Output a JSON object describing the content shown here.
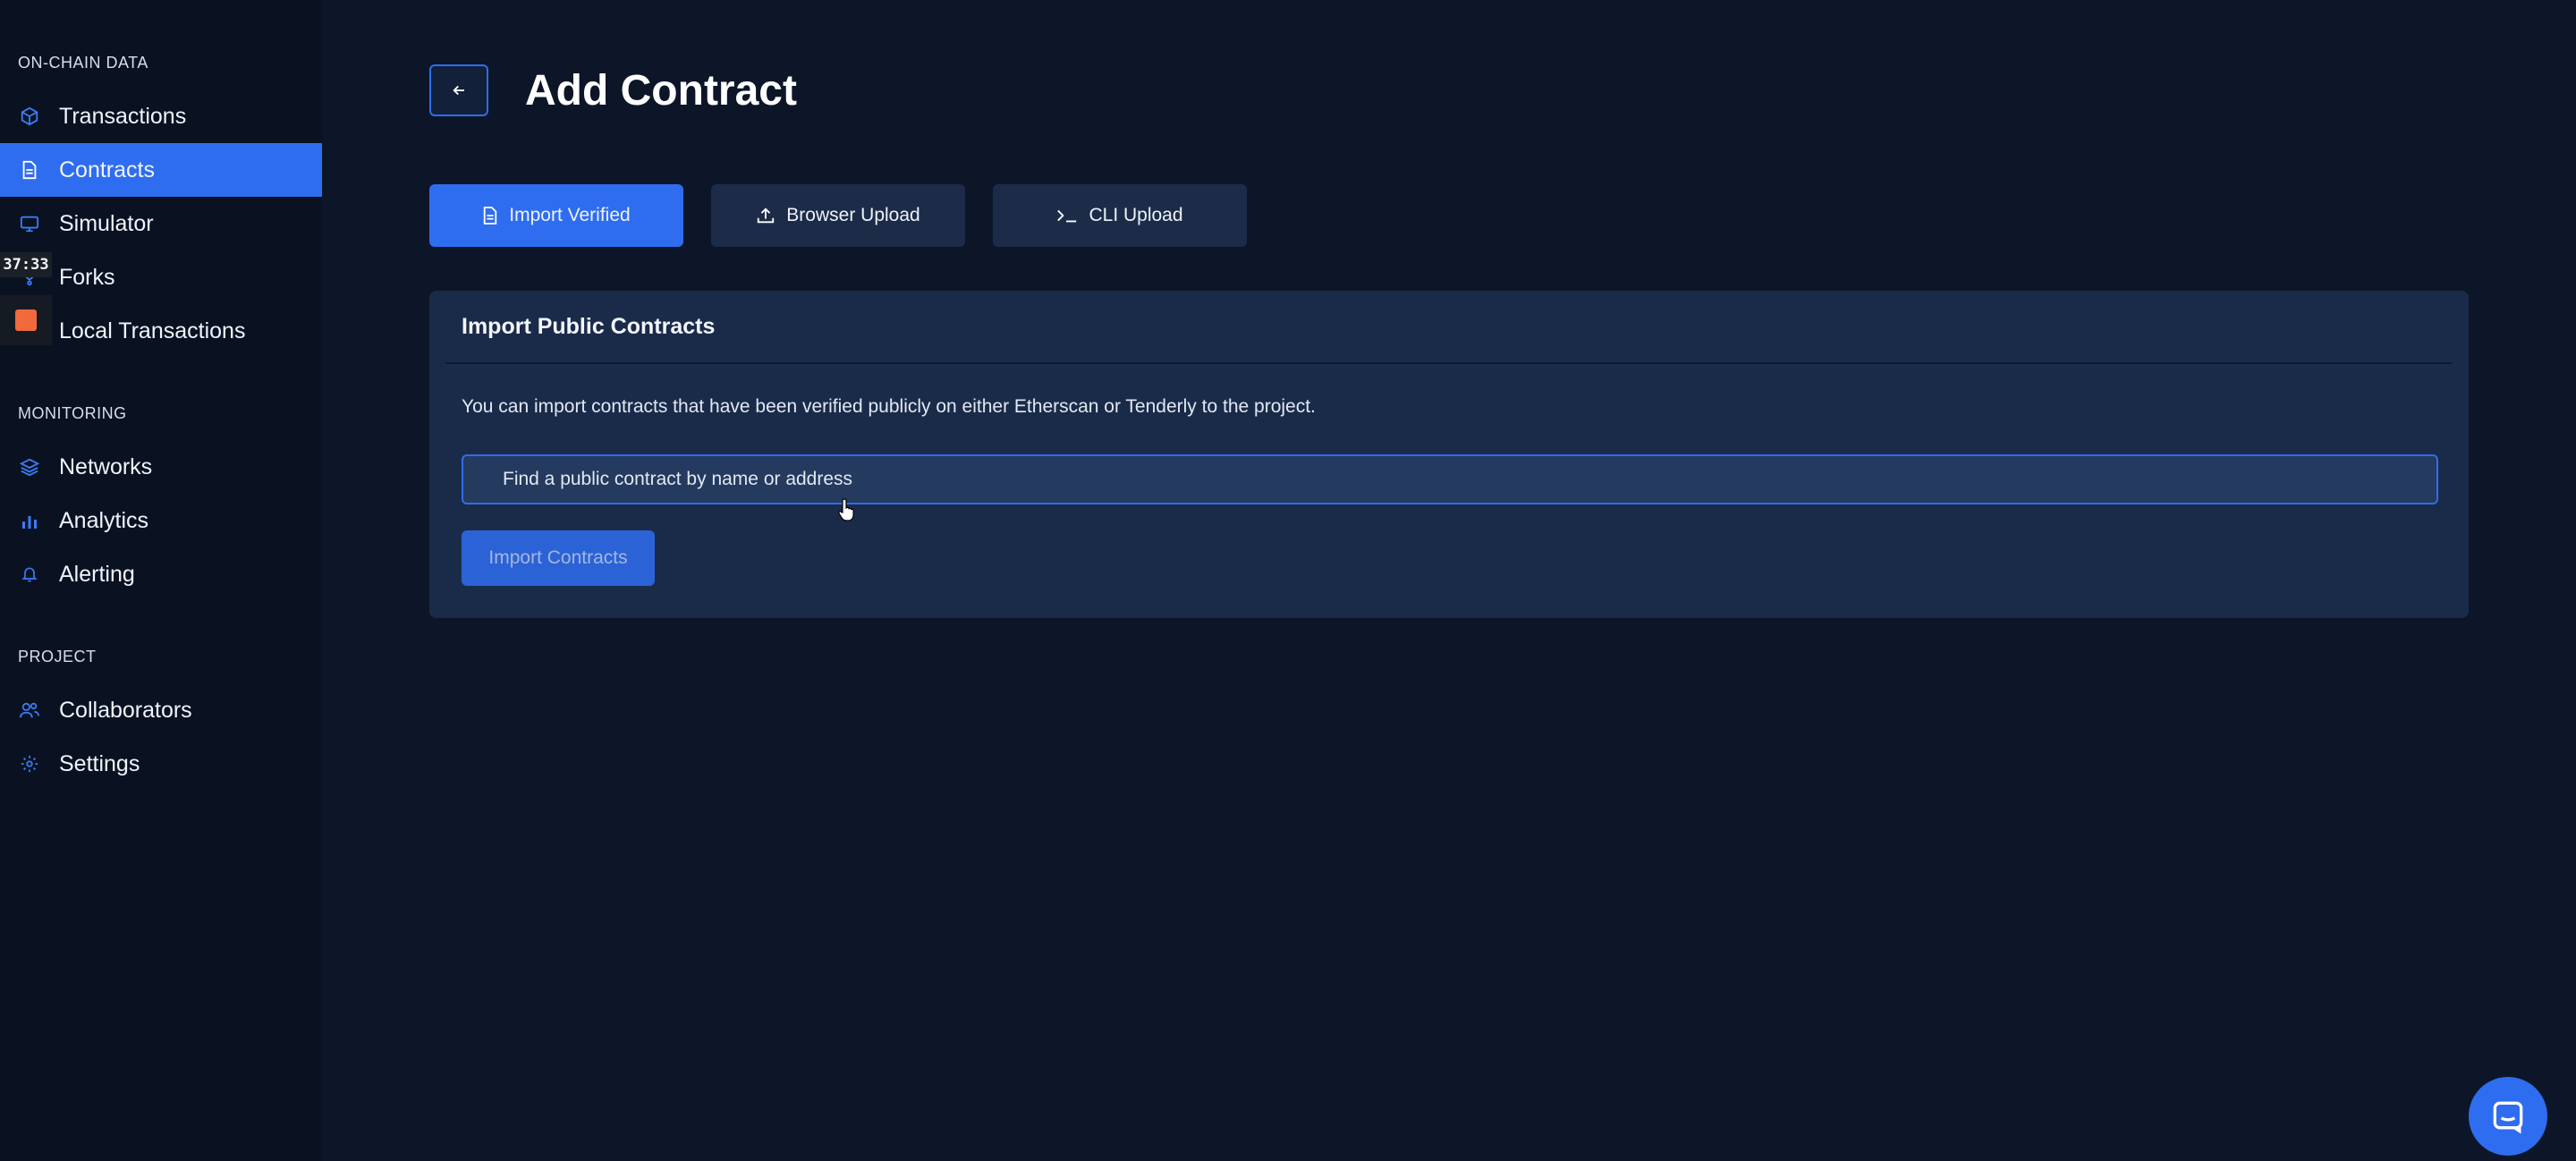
{
  "sidebar": {
    "sections": [
      {
        "label": "ON-CHAIN DATA"
      },
      {
        "label": "MONITORING"
      },
      {
        "label": "PROJECT"
      }
    ],
    "items": [
      {
        "label": "Transactions",
        "icon": "cube-icon"
      },
      {
        "label": "Contracts",
        "icon": "document-icon",
        "active": true
      },
      {
        "label": "Simulator",
        "icon": "monitor-icon"
      },
      {
        "label": "Forks",
        "icon": "fork-icon"
      },
      {
        "label": "Local Transactions",
        "icon": "terminal-icon"
      },
      {
        "label": "Networks",
        "icon": "layers-icon"
      },
      {
        "label": "Analytics",
        "icon": "bar-chart-icon"
      },
      {
        "label": "Alerting",
        "icon": "bell-icon"
      },
      {
        "label": "Collaborators",
        "icon": "users-icon"
      },
      {
        "label": "Settings",
        "icon": "gear-icon"
      }
    ],
    "timer": "37:33"
  },
  "header": {
    "title": "Add Contract"
  },
  "tabs": [
    {
      "label": "Import Verified",
      "icon": "document-icon",
      "active": true
    },
    {
      "label": "Browser Upload",
      "icon": "upload-icon"
    },
    {
      "label": "CLI Upload",
      "icon": "terminal-prompt-icon"
    }
  ],
  "card": {
    "title": "Import Public Contracts",
    "description": "You can import contracts that have been verified publicly on either Etherscan or Tenderly to the project.",
    "search_placeholder": "Find a public contract by name or address",
    "search_value": "",
    "import_button": "Import Contracts"
  },
  "colors": {
    "accent": "#2f6df0",
    "background": "#0d1628",
    "sidebar": "#0a1222",
    "card": "#1a2b4a"
  }
}
